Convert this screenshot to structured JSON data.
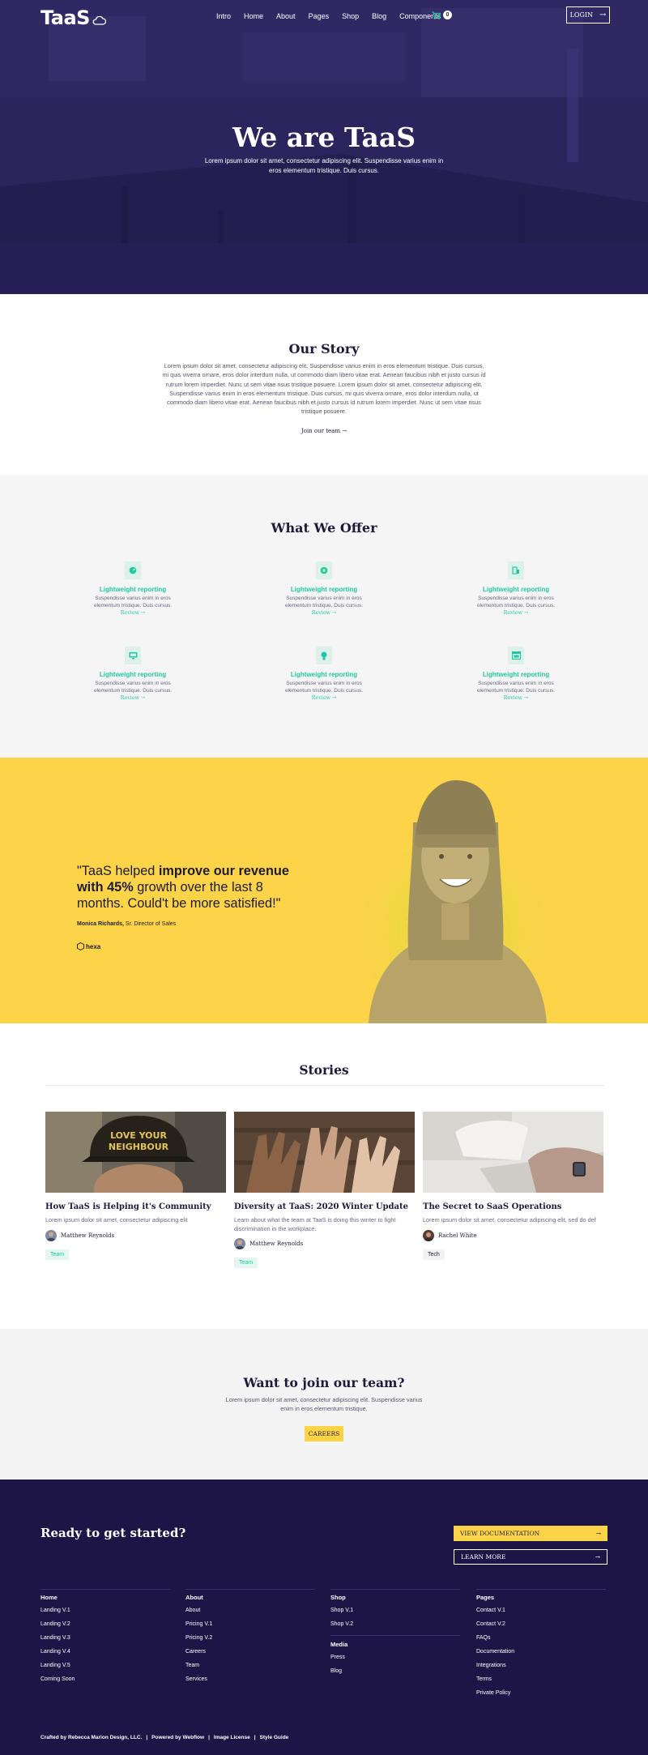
{
  "nav": {
    "logo": "TaaS",
    "links": [
      "Intro",
      "Home",
      "About",
      "Pages",
      "Shop",
      "Blog",
      "Components"
    ],
    "cart_count": "0",
    "login": "LOGIN"
  },
  "hero": {
    "title": "We are TaaS",
    "subtitle": "Lorem ipsum dolor sit amet, consectetur adipiscing elit. Suspendisse varius enim in eros elementum tristique. Duis cursus."
  },
  "story": {
    "title": "Our Story",
    "text": "Lorem ipsum dolor sit amet, consectetur adipiscing elit. Suspendisse varius enim in eros elementum tristique. Duis cursus, mi quis viverra ornare, eros dolor interdum nulla, ut commodo diam libero vitae erat. Aenean faucibus nibh et justo cursus id rutrum lorem imperdiet. Nunc ut sem vitae risus tristique posuere. Lorem ipsum dolor sit amet, consectetur adipiscing elit. Suspendisse varius enim in eros elementum tristique. Duis cursus, mi quis viverra ornare, eros dolor interdum nulla, ut commodo diam libero vitae erat. Aenean faucibus nibh et justo cursus id rutrum lorem imperdiet. Nunc ut sem vitae risus tristique posuere.",
    "link": "Join our team →"
  },
  "offer": {
    "title": "What We Offer",
    "features": [
      {
        "title": "Lightweight reporting",
        "text": "Suspendisse varius enim in eros elementum tristique. Duis cursus.",
        "link": "Review →",
        "icon": "gauge-icon"
      },
      {
        "title": "Lightweight reporting",
        "text": "Suspendisse varius enim in eros elementum tristique. Duis cursus.",
        "link": "Review →",
        "icon": "gear-icon"
      },
      {
        "title": "Lightweight reporting",
        "text": "Suspendisse varius enim in eros elementum tristique. Duis cursus.",
        "link": "Review →",
        "icon": "report-icon"
      },
      {
        "title": "Lightweight reporting",
        "text": "Suspendisse varius enim in eros elementum tristique. Duis cursus.",
        "link": "Review →",
        "icon": "monitor-icon"
      },
      {
        "title": "Lightweight reporting",
        "text": "Suspendisse varius enim in eros elementum tristique. Duis cursus.",
        "link": "Review →",
        "icon": "lightbulb-icon"
      },
      {
        "title": "Lightweight reporting",
        "text": "Suspendisse varius enim in eros elementum tristique. Duis cursus.",
        "link": "Review →",
        "icon": "browser-icon"
      }
    ]
  },
  "testimonial": {
    "quote_start": "\"TaaS helped ",
    "quote_bold": "improve our revenue with 45%",
    "quote_end": " growth over the last 8 months. Could't be more satisfied!\"",
    "author_name": "Monica Richards,",
    "author_role": " Sr. Director of Sales",
    "company": "hexa"
  },
  "stories": {
    "title": "Stories",
    "cards": [
      {
        "title": "How TaaS is Helping it's Community",
        "desc": "Lorem ipsum dolor sit amet, consectetur adipiscing elit",
        "author": "Matthew Reynolds",
        "tag": "Team",
        "image_text": "LOVE YOUR NEIGHBOUR"
      },
      {
        "title": "Diversity at TaaS: 2020 Winter Update",
        "desc": "Learn about what the team at TaaS is doing this winter to fight discrimination in the workplace.",
        "author": "Matthew Reynolds",
        "tag": "Team"
      },
      {
        "title": "The Secret to SaaS Operations",
        "desc": "Lorem ipsum dolor sit amet, consectetur adipiscing elit, sed do def",
        "author": "Rachel White",
        "tag": "Tech"
      }
    ]
  },
  "join": {
    "title": "Want to join our team?",
    "text": "Lorem ipsum dolor sit amet, consectetur adipiscing elit. Suspendisse varius enim in eros elementum tristique.",
    "button": "CAREERS"
  },
  "footer": {
    "title": "Ready to get started?",
    "btn_docs": "VIEW DOCUMENTATION",
    "btn_more": "LEARN MORE",
    "cols": [
      {
        "head": "Home",
        "links": [
          "Landing V.1",
          "Landing V.2",
          "Landing V.3",
          "Landing V.4",
          "Landing V.5",
          "Coming Soon"
        ]
      },
      {
        "head": "About",
        "links": [
          "About",
          "Pricing V.1",
          "Pricing V.2",
          "Careers",
          "Team",
          "Services"
        ]
      },
      {
        "head": "Shop",
        "links": [
          "Shop V.1",
          "Shop V.2"
        ],
        "sub_head": "Media",
        "sub_links": [
          "Press",
          "Blog"
        ]
      },
      {
        "head": "Pages",
        "links": [
          "Contact V.1",
          "Contact V.2",
          "FAQs",
          "Documentation",
          "Integrations",
          "Terms",
          "Private Policy"
        ]
      }
    ],
    "bottom": [
      "Crafted by Rebecca Marion Design, LLC.",
      "Powered by Webflow",
      "Image License",
      "Style Guide"
    ]
  },
  "colors": {
    "hero_bg": "#2a2359",
    "accent_green": "#22c7a0",
    "yellow": "#fdd348",
    "footer_bg": "#1c1546"
  }
}
